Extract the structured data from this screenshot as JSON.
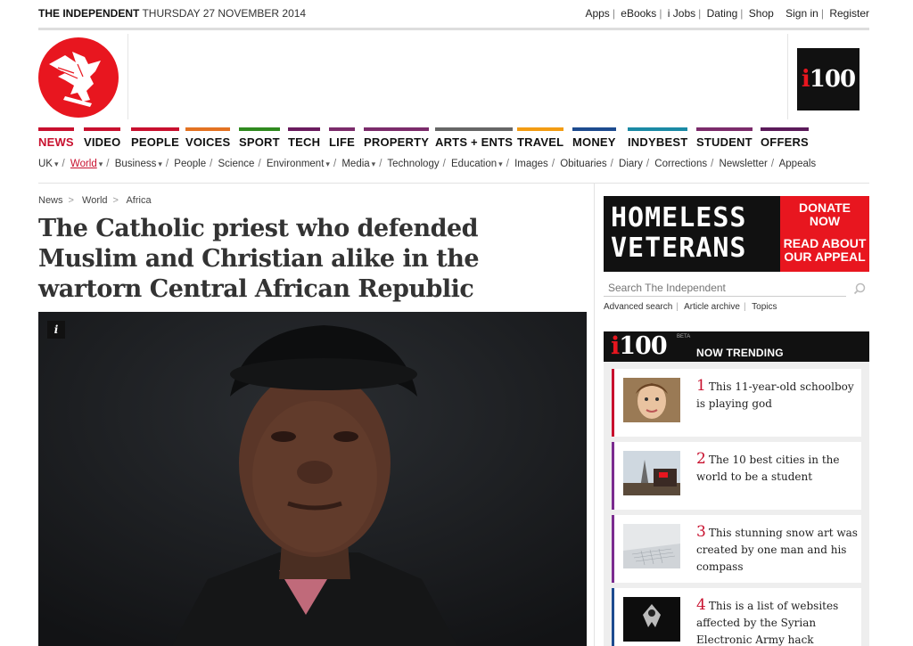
{
  "header": {
    "brand": "THE INDEPENDENT",
    "date": "THURSDAY 27 NOVEMBER 2014",
    "links": [
      "Apps",
      "eBooks",
      "i Jobs",
      "Dating",
      "Shop",
      "Sign in",
      "Register"
    ]
  },
  "i100_badge": {
    "i": "i",
    "rest": "100"
  },
  "main_nav": [
    {
      "label": "NEWS",
      "color": "#c8102e"
    },
    {
      "label": "VIDEO",
      "color": "#c8102e"
    },
    {
      "label": "PEOPLE",
      "color": "#c8102e"
    },
    {
      "label": "VOICES",
      "color": "#e37222"
    },
    {
      "label": "SPORT",
      "color": "#2f8a1e"
    },
    {
      "label": "TECH",
      "color": "#6a1b5e"
    },
    {
      "label": "LIFE",
      "color": "#7b2b6b"
    },
    {
      "label": "PROPERTY",
      "color": "#7b2b6b"
    },
    {
      "label": "ARTS + ENTS",
      "color": "#666666"
    },
    {
      "label": "TRAVEL",
      "color": "#f39c12"
    },
    {
      "label": "MONEY",
      "color": "#1d4b8f"
    },
    {
      "label": "INDYBEST",
      "color": "#1a8aa5"
    },
    {
      "label": "STUDENT",
      "color": "#7b2b6b"
    },
    {
      "label": "OFFERS",
      "color": "#5b1a5a"
    }
  ],
  "sub_nav": [
    {
      "label": "UK",
      "dropdown": true
    },
    {
      "label": "World",
      "dropdown": true,
      "active": true
    },
    {
      "label": "Business",
      "dropdown": true
    },
    {
      "label": "People"
    },
    {
      "label": "Science"
    },
    {
      "label": "Environment",
      "dropdown": true
    },
    {
      "label": "Media",
      "dropdown": true
    },
    {
      "label": "Technology"
    },
    {
      "label": "Education",
      "dropdown": true
    },
    {
      "label": "Images"
    },
    {
      "label": "Obituaries"
    },
    {
      "label": "Diary"
    },
    {
      "label": "Corrections"
    },
    {
      "label": "Newsletter"
    },
    {
      "label": "Appeals"
    }
  ],
  "breadcrumb": [
    "News",
    "World",
    "Africa"
  ],
  "article": {
    "headline": "The Catholic priest who defended Muslim and Christian alike in the wartorn Central African Republic",
    "image_info": "i"
  },
  "ad": {
    "line1": "HOMELESS",
    "line2": "VETERANS",
    "cta1": "DONATE",
    "cta2": "NOW",
    "cta3": "READ ABOUT",
    "cta4": "OUR APPEAL"
  },
  "search": {
    "placeholder": "Search The Independent",
    "links": [
      "Advanced search",
      "Article archive",
      "Topics"
    ]
  },
  "trending": {
    "logo_i": "i",
    "logo_rest": "100",
    "beta": "BETA",
    "title": "NOW TRENDING",
    "items": [
      {
        "num": "1",
        "text": "This 11-year-old schoolboy is playing god",
        "color": "#c8102e"
      },
      {
        "num": "2",
        "text": "The 10 best cities in the world to be a student",
        "color": "#7b2b8f"
      },
      {
        "num": "3",
        "text": "This stunning snow art was created by one man and his compass",
        "color": "#7b2b8f"
      },
      {
        "num": "4",
        "text": "This is a list of websites affected by the Syrian Electronic Army hack",
        "color": "#1d4b8f"
      }
    ]
  },
  "colors": {
    "brand_red": "#e8161f",
    "news_red": "#c8102e"
  }
}
